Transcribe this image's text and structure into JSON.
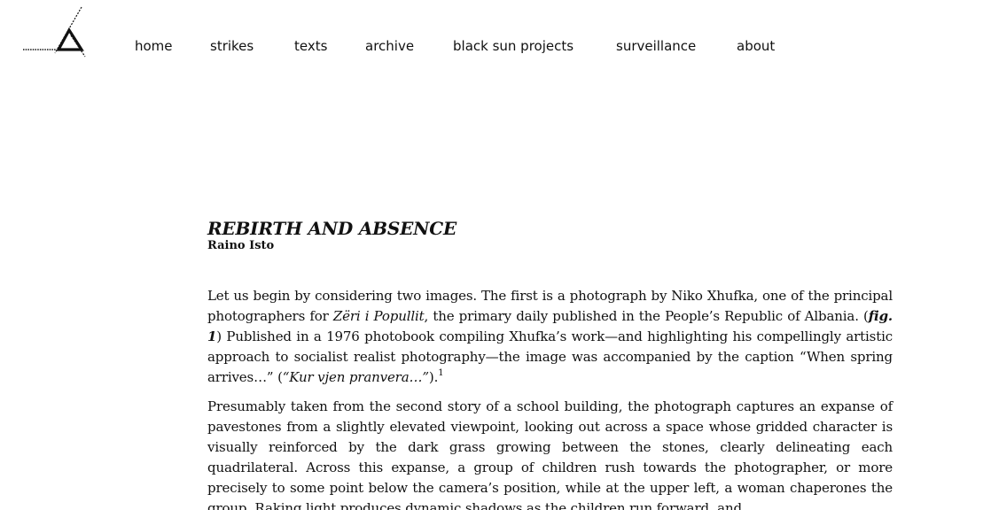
{
  "nav": {
    "items": [
      "home",
      "strikes",
      "texts",
      "archive",
      "black sun projects",
      "surveillance",
      "about"
    ]
  },
  "article": {
    "title": "REBIRTH AND ABSENCE",
    "author": "Raino Isto",
    "p1": {
      "a": "Let us begin by considering two images. The first is a photograph by Niko Xhufka, one of the principal photographers for ",
      "b": "Zëri i Popullit",
      "c": ", the primary daily published in the People’s Republic of Albania. (",
      "d": "fig. 1",
      "e": ") Published in a 1976 photobook compiling Xhufka’s work—and highlighting his compellingly artistic approach to socialist realist photography—the image was accompanied by the caption “When spring arrives…” (",
      "f": "“Kur vjen pranvera…”",
      "g": ").",
      "footnote": "1"
    },
    "p2": "Presumably taken from the second story of a school building, the photograph captures an expanse of pavestones from a slightly elevated viewpoint, looking out across a space whose gridded character is visually reinforced by the dark grass growing between the stones, clearly delineating each quadrilateral. Across this expanse, a group of children rush towards the photographer, or more precisely to some point below the camera’s position, while at the upper left, a woman chaperones the group. Raking light produces dynamic shadows as the children run forward, and"
  }
}
